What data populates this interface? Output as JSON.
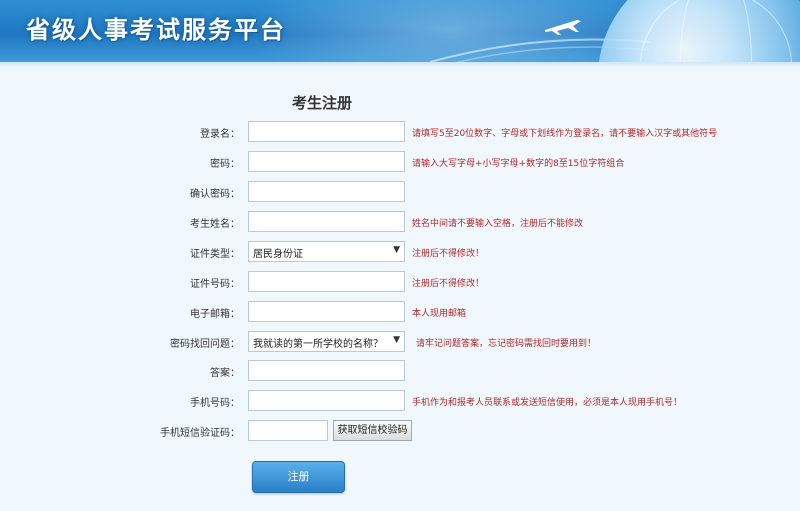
{
  "header": {
    "title": "省级人事考试服务平台"
  },
  "form": {
    "title": "考生注册",
    "rows": [
      {
        "label": "登录名：",
        "type": "text",
        "value": "",
        "hint": "请填写5至20位数字、字母或下划线作为登录名，请不要输入汉字或其他符号"
      },
      {
        "label": "密码：",
        "type": "password",
        "value": "",
        "hint": "请输入大写字母+小写字母+数字的8至15位字符组合"
      },
      {
        "label": "确认密码：",
        "type": "password",
        "value": "",
        "hint": ""
      },
      {
        "label": "考生姓名：",
        "type": "text",
        "value": "",
        "hint": "姓名中间请不要输入空格，注册后不能修改"
      },
      {
        "label": "证件类型：",
        "type": "select",
        "value": "居民身份证",
        "hint": "注册后不得修改！"
      },
      {
        "label": "证件号码：",
        "type": "text",
        "value": "",
        "hint": "注册后不得修改！"
      },
      {
        "label": "电子邮箱：",
        "type": "text",
        "value": "",
        "hint": "本人现用邮箱"
      },
      {
        "label": "密码找回问题：",
        "type": "select",
        "value": "我就读的第一所学校的名称？",
        "hint": "请牢记问题答案，忘记密码需找回时要用到！"
      },
      {
        "label": "答案：",
        "type": "text",
        "value": "",
        "hint": ""
      },
      {
        "label": "手机号码：",
        "type": "text",
        "value": "",
        "hint": "手机作为和报考人员联系或发送短信使用，必须是本人现用手机号！"
      },
      {
        "label": "手机短信验证码：",
        "type": "sms",
        "value": "",
        "hint": ""
      }
    ],
    "sms_button": "获取短信校验码",
    "submit_label": "注册"
  },
  "colors": {
    "accent": "#2a7fc6",
    "hint": "#b2282a",
    "header": "#1f78c2"
  }
}
